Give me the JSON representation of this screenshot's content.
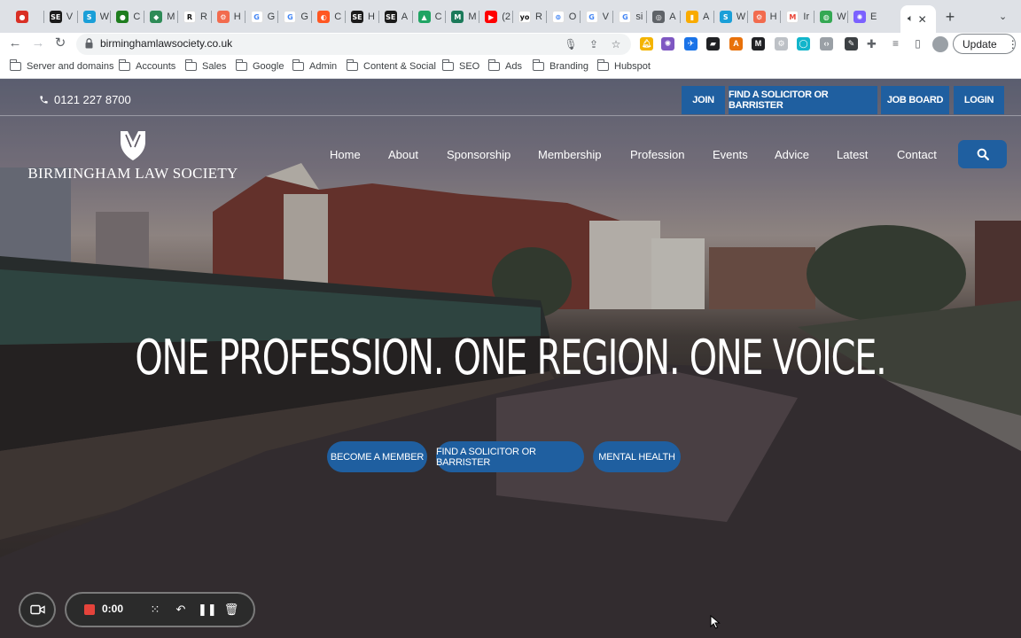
{
  "browser": {
    "tabs": [
      {
        "letter": "",
        "color": "#d93025",
        "glyph": "●"
      },
      {
        "letter": "V",
        "color": "#1b1b1b",
        "glyph": "SE"
      },
      {
        "letter": "W",
        "color": "#1a9fd8",
        "glyph": "S"
      },
      {
        "letter": "C",
        "color": "#1e7d1e",
        "glyph": "●"
      },
      {
        "letter": "M",
        "color": "#2e8b57",
        "glyph": "◆"
      },
      {
        "letter": "R",
        "color": "#ffffff",
        "glyph": "R",
        "glyph_color": "#111111"
      },
      {
        "letter": "H",
        "color": "#f26b4e",
        "glyph": "⚙"
      },
      {
        "letter": "G",
        "color": "#ffffff",
        "glyph": "G",
        "glyph_color": "#4285f4"
      },
      {
        "letter": "G",
        "color": "#ffffff",
        "glyph": "G",
        "glyph_color": "#4285f4"
      },
      {
        "letter": "C",
        "color": "#ff5722",
        "glyph": "◐"
      },
      {
        "letter": "H",
        "color": "#1b1b1b",
        "glyph": "SE"
      },
      {
        "letter": "A",
        "color": "#1b1b1b",
        "glyph": "SE"
      },
      {
        "letter": "C",
        "color": "#1fa463",
        "glyph": "▲"
      },
      {
        "letter": "M",
        "color": "#1b7a5a",
        "glyph": "M"
      },
      {
        "letter": "(2",
        "color": "#ff0000",
        "glyph": "▶"
      },
      {
        "letter": "R",
        "color": "#ffffff",
        "glyph": "yo",
        "glyph_color": "#111111"
      },
      {
        "letter": "O",
        "color": "#ffffff",
        "glyph": "⊚",
        "glyph_color": "#4285f4"
      },
      {
        "letter": "V",
        "color": "#ffffff",
        "glyph": "G",
        "glyph_color": "#4285f4"
      },
      {
        "letter": "si",
        "color": "#ffffff",
        "glyph": "G",
        "glyph_color": "#4285f4"
      },
      {
        "letter": "A",
        "color": "#5f6368",
        "glyph": "◎"
      },
      {
        "letter": "A",
        "color": "#f9ab00",
        "glyph": "▮"
      },
      {
        "letter": "W",
        "color": "#1a9fd8",
        "glyph": "S"
      },
      {
        "letter": "H",
        "color": "#f26b4e",
        "glyph": "⚙"
      },
      {
        "letter": "Ir",
        "color": "#ffffff",
        "glyph": "M",
        "glyph_color": "#ea4335"
      },
      {
        "letter": "W",
        "color": "#34a853",
        "glyph": "◍"
      },
      {
        "letter": "E",
        "color": "#7b61ff",
        "glyph": "✺"
      }
    ],
    "active_tab_icon": "speaker-icon",
    "url": "birminghamlawsociety.co.uk",
    "update_label": "Update",
    "bookmarks": [
      "Server and domains",
      "Accounts",
      "Sales",
      "Google",
      "Admin",
      "Content & Social",
      "SEO",
      "Ads",
      "Branding",
      "Hubspot"
    ]
  },
  "site": {
    "phone": "0121 227 8700",
    "top_buttons": [
      "JOIN",
      "FIND A SOLICITOR OR BARRISTER",
      "JOB BOARD",
      "LOGIN"
    ],
    "logo_text": "BIRMINGHAM LAW SOCIETY",
    "nav": [
      "Home",
      "About",
      "Sponsorship",
      "Membership",
      "Profession",
      "Events",
      "Advice",
      "Latest",
      "Contact"
    ],
    "headline": "ONE PROFESSION. ONE REGION. ONE VOICE.",
    "cta_buttons": [
      "BECOME A MEMBER",
      "FIND A SOLICITOR OR BARRISTER",
      "MENTAL HEALTH"
    ],
    "accent_color": "#1f5fa0"
  },
  "recorder": {
    "time": "0:00"
  }
}
